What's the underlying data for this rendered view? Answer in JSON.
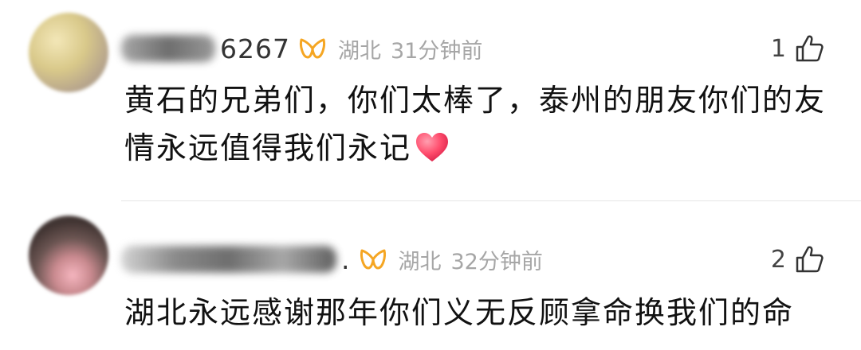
{
  "comments": [
    {
      "username": "6267",
      "location": "湖北",
      "time": "31分钟前",
      "likes": "1",
      "text": "黄石的兄弟们，你们太棒了，泰州的朋友你们的友情永远值得我们永记",
      "emoji": "heart-icon"
    },
    {
      "username": ".",
      "location": "湖北",
      "time": "32分钟前",
      "likes": "2",
      "text": "湖北永远感谢那年你们义无反顾拿命换我们的命"
    }
  ],
  "colors": {
    "vip_badge": "#f5a623",
    "meta_text": "#a6a6a6",
    "heart": "#ff4d6d"
  }
}
